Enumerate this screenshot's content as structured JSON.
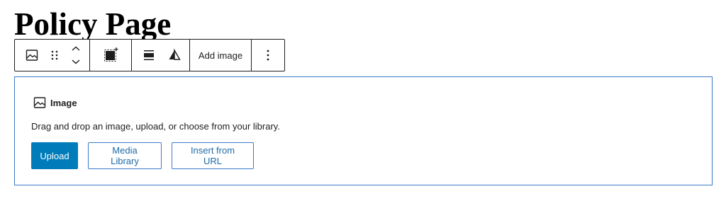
{
  "page": {
    "title": "Policy Page"
  },
  "toolbar": {
    "block_type_icon": "image-icon",
    "drag_icon": "drag-handle-icon",
    "move_up_icon": "chevron-up-icon",
    "move_down_icon": "chevron-down-icon",
    "size_icon": "resize-icon",
    "align_icon": "align-center-icon",
    "duotone_icon": "duotone-icon",
    "add_image_label": "Add image",
    "more_icon": "more-vertical-icon"
  },
  "placeholder": {
    "label": "Image",
    "instructions": "Drag and drop an image, upload, or choose from your library.",
    "upload_label": "Upload",
    "media_library_label": "Media Library",
    "insert_url_label": "Insert from URL"
  },
  "colors": {
    "primary": "#007cba",
    "focus_border": "#3a7bc8",
    "text": "#1e1e1e"
  }
}
